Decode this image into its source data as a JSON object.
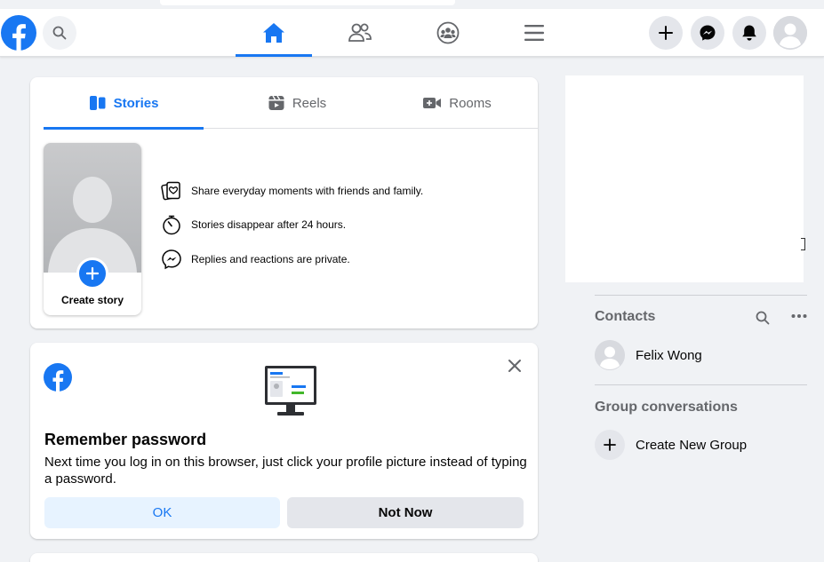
{
  "colors": {
    "accent": "#1877f2",
    "background": "#f0f2f5",
    "secondary_text": "#65676b",
    "button_gray": "#e4e6eb",
    "ok_button_bg": "#e7f3ff"
  },
  "header": {
    "logo_icon": "facebook-logo-icon",
    "search_icon": "search-icon",
    "nav_tabs": [
      {
        "icon": "home-icon",
        "active": true
      },
      {
        "icon": "friends-icon",
        "active": false
      },
      {
        "icon": "groups-icon",
        "active": false
      },
      {
        "icon": "menu-icon",
        "active": false
      }
    ],
    "actions": [
      {
        "icon": "plus-icon"
      },
      {
        "icon": "messenger-icon"
      },
      {
        "icon": "bell-icon"
      },
      {
        "icon": "profile-avatar-icon"
      }
    ]
  },
  "stories_card": {
    "tabs": [
      {
        "label": "Stories",
        "icon": "stories-icon",
        "active": true
      },
      {
        "label": "Reels",
        "icon": "reels-icon",
        "active": false
      },
      {
        "label": "Rooms",
        "icon": "video-icon",
        "active": false
      }
    ],
    "create_story_label": "Create story",
    "features": [
      {
        "icon": "photos-heart-icon",
        "text": "Share everyday moments with friends and family."
      },
      {
        "icon": "stopwatch-icon",
        "text": "Stories disappear after 24 hours."
      },
      {
        "icon": "messenger-icon",
        "text": "Replies and reactions are private."
      }
    ]
  },
  "password_card": {
    "title": "Remember password",
    "body": "Next time you log in on this browser, just click your profile picture instead of typing a password.",
    "ok_label": "OK",
    "not_now_label": "Not Now"
  },
  "contacts": {
    "title": "Contacts",
    "items": [
      {
        "name": "Felix Wong"
      }
    ]
  },
  "group_conversations": {
    "title": "Group conversations",
    "create_label": "Create New Group"
  }
}
